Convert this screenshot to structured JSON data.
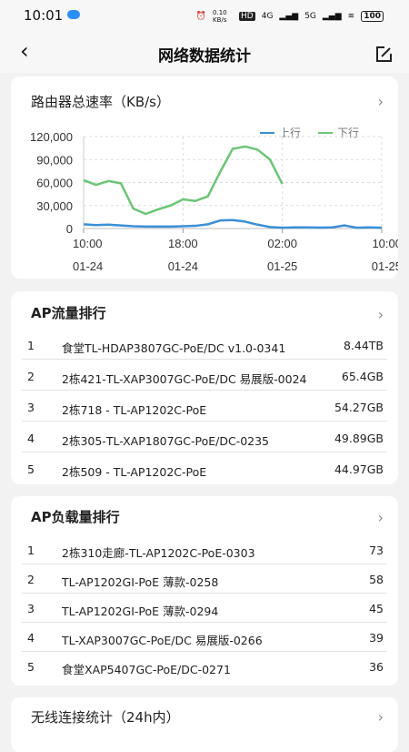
{
  "status": {
    "time": "10:01",
    "net_speed": "0.10 KB/s",
    "hd": "HD",
    "signal1": "4G",
    "signal2": "5G",
    "battery": "100"
  },
  "header": {
    "title": "网络数据统计"
  },
  "rate_card": {
    "title": "路由器总速率（KB/s）",
    "legend_up": "上行",
    "legend_down": "下行",
    "colors": {
      "up": "#3b8fd6",
      "down": "#6cc576"
    }
  },
  "chart_data": {
    "type": "line",
    "ylim": [
      0,
      120000
    ],
    "yticks": [
      "120,000",
      "90,000",
      "60,000",
      "30,000",
      "0"
    ],
    "xticks": [
      {
        "time": "10:00",
        "date": "01-24"
      },
      {
        "time": "18:00",
        "date": "01-24"
      },
      {
        "time": "02:00",
        "date": "01-25"
      },
      {
        "time": "10:00",
        "date": "01-25"
      }
    ],
    "x": [
      0,
      1,
      2,
      3,
      4,
      5,
      6,
      7,
      8,
      9,
      10,
      11,
      12,
      13,
      14,
      15,
      16,
      17,
      18,
      19,
      20,
      21,
      22,
      23,
      24
    ],
    "series": [
      {
        "name": "上行",
        "values": [
          5500,
          4500,
          5000,
          4000,
          3000,
          2500,
          2500,
          2500,
          3000,
          3500,
          5500,
          10500,
          11000,
          9000,
          5000,
          2000,
          1000,
          1500,
          1500,
          1200,
          1500,
          4000,
          1000,
          1500,
          1000
        ]
      },
      {
        "name": "下行",
        "values": [
          63000,
          57000,
          62000,
          59000,
          26000,
          19000,
          25000,
          30000,
          38000,
          36000,
          42000,
          74000,
          104000,
          107000,
          103000,
          90000,
          58000
        ]
      }
    ]
  },
  "traffic_card": {
    "title": "AP流量排行",
    "items": [
      {
        "rank": "1",
        "name": "食堂TL-HDAP3807GC-PoE/DC v1.0-0341",
        "value": "8.44TB"
      },
      {
        "rank": "2",
        "name": "2栋421-TL-XAP3007GC-PoE/DC 易展版-0024",
        "value": "65.4GB"
      },
      {
        "rank": "3",
        "name": "2栋718 - TL-AP1202C-PoE",
        "value": "54.27GB"
      },
      {
        "rank": "4",
        "name": "2栋305-TL-XAP1807GC-PoE/DC-0235",
        "value": "49.89GB"
      },
      {
        "rank": "5",
        "name": "2栋509 - TL-AP1202C-PoE",
        "value": "44.97GB"
      }
    ]
  },
  "load_card": {
    "title": "AP负载量排行",
    "items": [
      {
        "rank": "1",
        "name": "2栋310走廊-TL-AP1202C-PoE-0303",
        "value": "73"
      },
      {
        "rank": "2",
        "name": "TL-AP1202GI-PoE 薄款-0258",
        "value": "58"
      },
      {
        "rank": "3",
        "name": "TL-AP1202GI-PoE 薄款-0294",
        "value": "45"
      },
      {
        "rank": "4",
        "name": "TL-XAP3007GC-PoE/DC 易展版-0266",
        "value": "39"
      },
      {
        "rank": "5",
        "name": "食堂XAP5407GC-PoE/DC-0271",
        "value": "36"
      }
    ]
  },
  "wireless_card": {
    "title": "无线连接统计（24h内）"
  }
}
